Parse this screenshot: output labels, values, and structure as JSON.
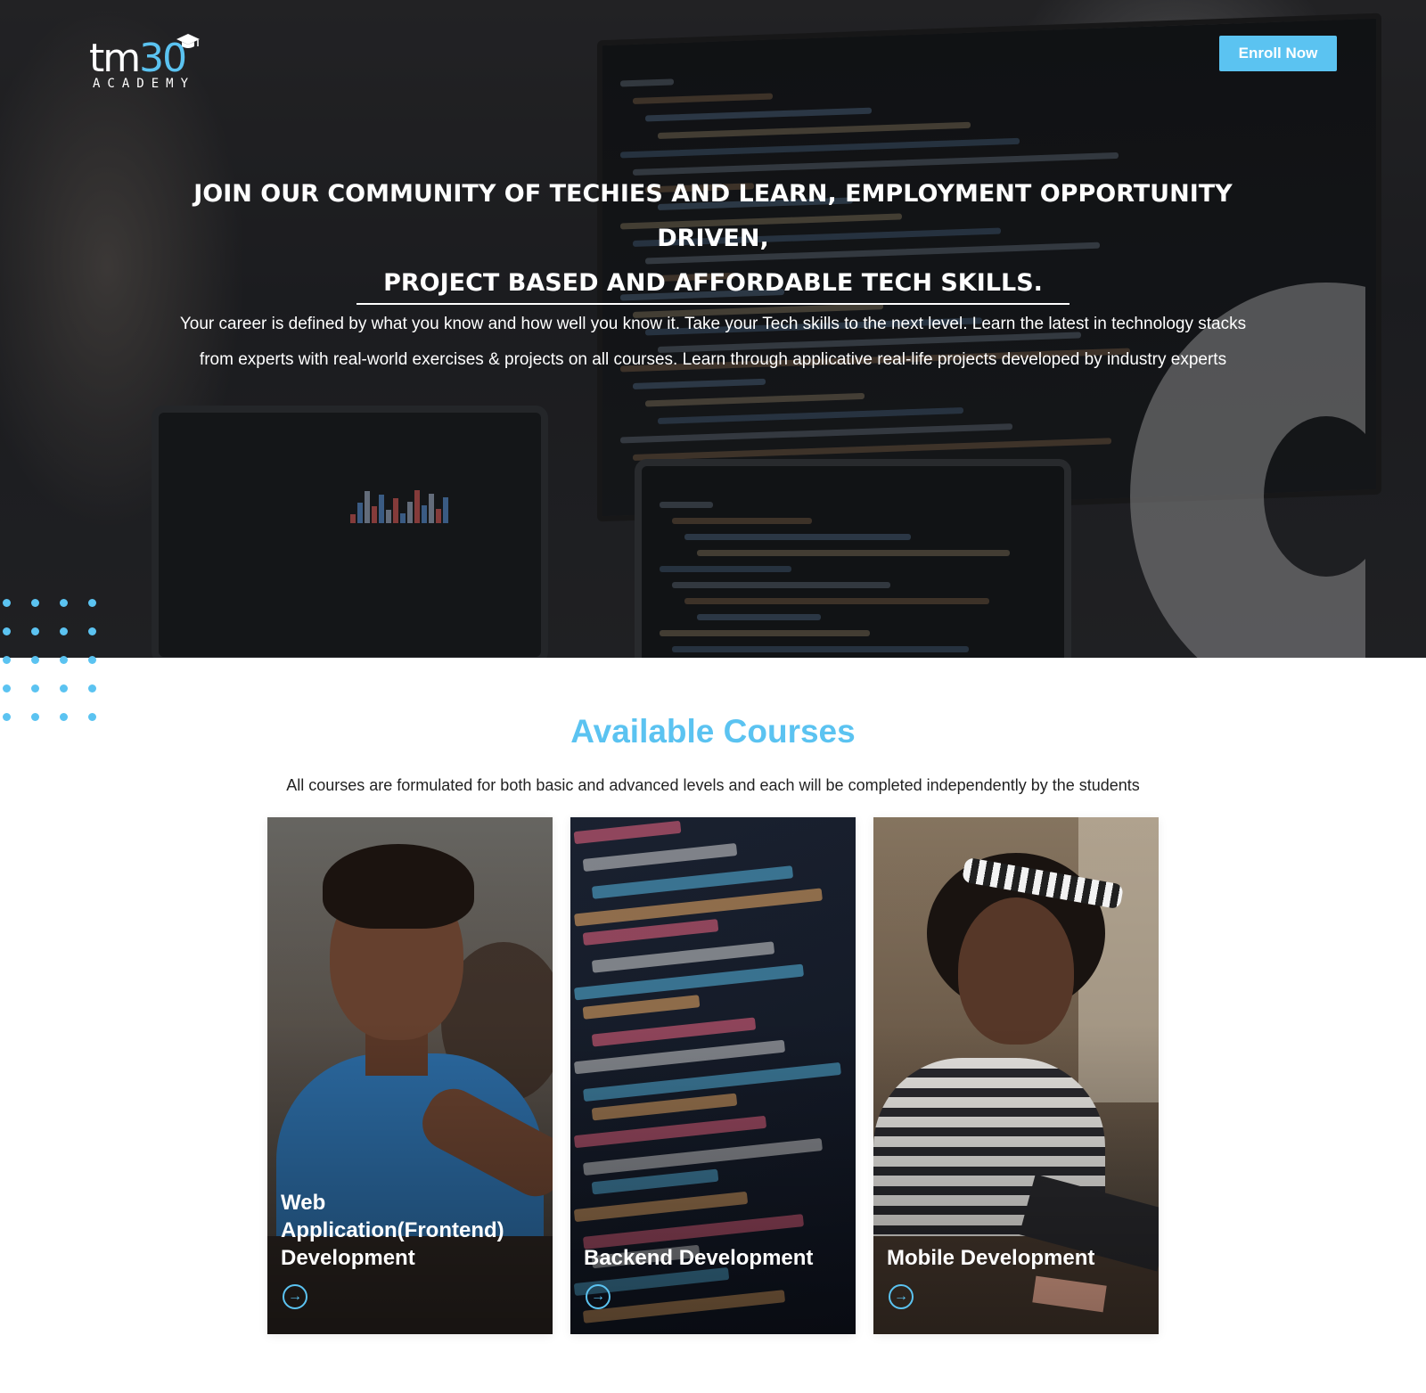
{
  "header": {
    "logo_main": "tm",
    "logo_num": "30",
    "logo_sub": "ACADEMY",
    "enroll_label": "Enroll Now"
  },
  "hero": {
    "title_line1": "JOIN OUR COMMUNITY OF TECHIES AND LEARN, EMPLOYMENT OPPORTUNITY DRIVEN,",
    "title_line2": "PROJECT BASED AND AFFORDABLE TECH SKILLS.",
    "description": "Your career is defined by what you know and how well you know it. Take your Tech skills to the next level. Learn the latest in technology stacks from experts with real-world exercises & projects on all courses. Learn through applicative real-life projects developed by industry experts"
  },
  "courses": {
    "title": "Available Courses",
    "subtitle": "All courses are formulated for both basic and advanced levels and each will be completed independently by the students",
    "items": [
      {
        "title": "Web Application(Frontend) Development",
        "arrow": "arrow-right-circle-icon"
      },
      {
        "title": "Backend Development",
        "arrow": "arrow-right-circle-icon"
      },
      {
        "title": "Mobile Development",
        "arrow": "arrow-right-circle-icon"
      }
    ]
  },
  "colors": {
    "accent": "#5bc3f1",
    "text_dark": "#222222"
  }
}
